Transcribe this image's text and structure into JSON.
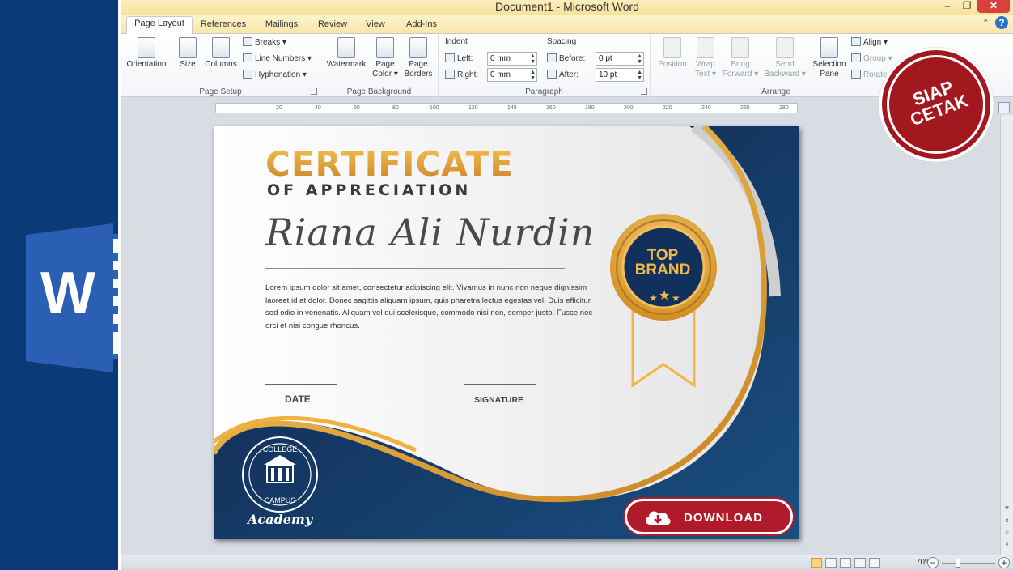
{
  "window": {
    "title": "Document1 - Microsoft Word",
    "minimize": "–",
    "maximize": "❐",
    "close": "✕"
  },
  "tabs": [
    {
      "label": "Page Layout",
      "active": true
    },
    {
      "label": "References"
    },
    {
      "label": "Mailings"
    },
    {
      "label": "Review"
    },
    {
      "label": "View"
    },
    {
      "label": "Add-Ins"
    }
  ],
  "help": {
    "caret": "⌃",
    "icon": "?"
  },
  "ribbon": {
    "page_setup": {
      "label": "Page Setup",
      "orientation": "Orientation",
      "size": "Size",
      "columns": "Columns",
      "breaks": "Breaks ▾",
      "line_numbers": "Line Numbers ▾",
      "hyphenation": "Hyphenation ▾"
    },
    "page_background": {
      "label": "Page Background",
      "watermark": "Watermark",
      "page_color_1": "Page",
      "page_color_2": "Color ▾",
      "page_borders_1": "Page",
      "page_borders_2": "Borders"
    },
    "paragraph": {
      "label": "Paragraph",
      "indent": "Indent",
      "spacing": "Spacing",
      "left_label": "Left:",
      "left_value": "0 mm",
      "right_label": "Right:",
      "right_value": "0 mm",
      "before_label": "Before:",
      "before_value": "0 pt",
      "after_label": "After:",
      "after_value": "10 pt"
    },
    "arrange": {
      "label": "Arrange",
      "position": "Position",
      "wrap_1": "Wrap",
      "wrap_2": "Text ▾",
      "bring_1": "Bring",
      "bring_2": "Forward ▾",
      "send_1": "Send",
      "send_2": "Backward ▾",
      "selection_1": "Selection",
      "selection_2": "Pane",
      "align": "Align ▾",
      "group": "Group ▾",
      "rotate": "Rotate"
    }
  },
  "ruler": {
    "ticks": [
      "20",
      "40",
      "60",
      "80",
      "100",
      "120",
      "140",
      "160",
      "180",
      "200",
      "220",
      "240",
      "260",
      "280"
    ]
  },
  "certificate": {
    "title": "CERTIFICATE",
    "subtitle": "OF APPRECIATION",
    "recipient": "Riana Ali Nurdin",
    "body": "Lorem ipsum dolor sit amet, consectetur adipiscing elit. Vivamus in nunc non neque dignissim laoreet id at dolor. Donec sagittis aliquam ipsum, quis pharetra lectus egestas vel. Duis efficitur sed odio in venenatis. Aliquam vel dui scelerisque, commodo nisi non, semper justo. Fusce nec orci et nisi congue rhoncus.",
    "date_label": "DATE",
    "signature_label": "SIGNATURE",
    "badge_line1": "TOP",
    "badge_line2": "BRAND",
    "seal_top": "COLLEGE",
    "seal_bottom": "CAMPUS",
    "academy": "Academy",
    "colors": {
      "navy": "#0e2a55",
      "gold": "#e8a531",
      "red": "#c81f43"
    }
  },
  "overlay": {
    "download": "DOWNLOAD",
    "stamp": "SIAP\nCETAK"
  },
  "status": {
    "zoom": "70%",
    "zoom_minus": "−",
    "zoom_plus": "+"
  },
  "icons": {
    "word_logo": "word-logo-icon",
    "cloud": "cloud-download-icon"
  }
}
